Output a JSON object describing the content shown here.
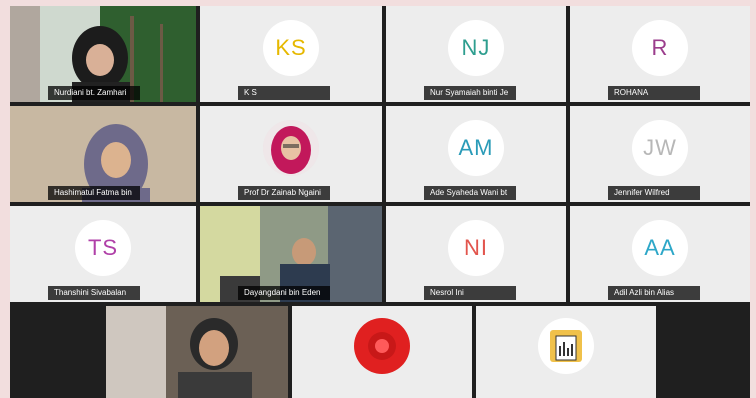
{
  "participants": [
    {
      "name": "Nurdiani bt. Zamhari",
      "type": "video"
    },
    {
      "name": "K S",
      "initials": "KS",
      "color": "#e6b800"
    },
    {
      "name": "Nur Syamaiah binti Je",
      "initials": "NJ",
      "color": "#2e9e8f"
    },
    {
      "name": "ROHANA",
      "initials": "R",
      "color": "#9b3d8c"
    },
    {
      "name": "Hashimatul Fatma bin",
      "type": "video"
    },
    {
      "name": "Prof Dr Zainab Ngaini",
      "type": "photo"
    },
    {
      "name": "Ade Syaheda Wani bt",
      "initials": "AM",
      "color": "#2a9bb8"
    },
    {
      "name": "Jennifer Wilfred",
      "initials": "JW",
      "color": "#b7b7b7"
    },
    {
      "name": "Thanshini Sivabalan",
      "initials": "TS",
      "color": "#b040a8"
    },
    {
      "name": "Dayangdani bin Eden",
      "type": "video"
    },
    {
      "name": "Nesrol Ini",
      "initials": "NI",
      "color": "#e2554d"
    },
    {
      "name": "Adil Azli bin Alias",
      "initials": "AA",
      "color": "#2da7c8"
    }
  ],
  "bottom_row": [
    {
      "type": "video"
    },
    {
      "type": "red-avatar"
    },
    {
      "type": "document-avatar"
    }
  ]
}
